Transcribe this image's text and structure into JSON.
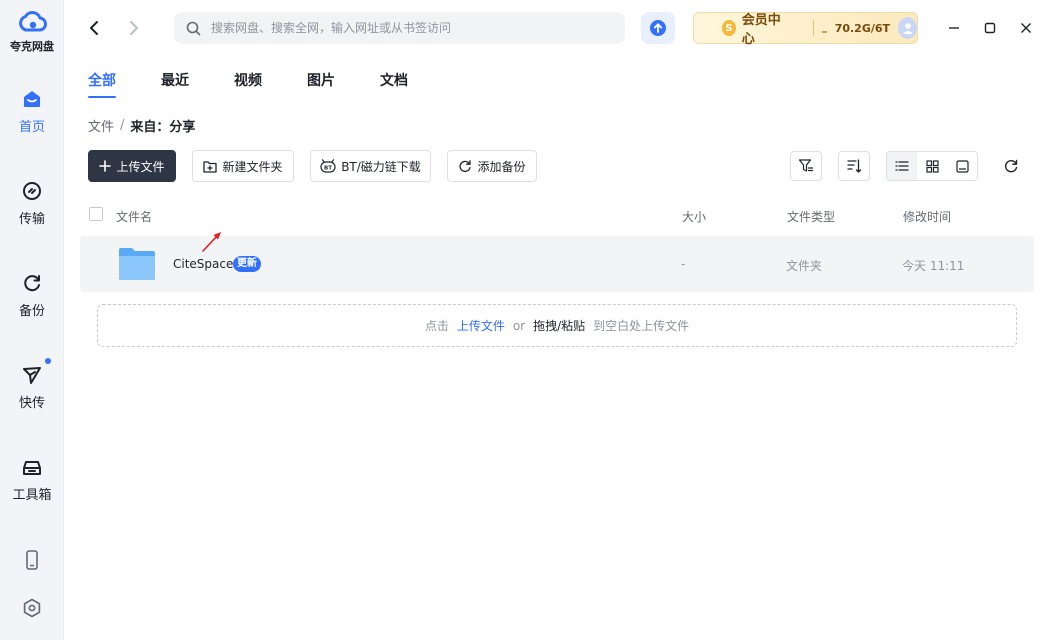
{
  "app": {
    "logo_text": "夸克网盘"
  },
  "sidebar": {
    "items": [
      {
        "label": "首页",
        "icon": "home-icon"
      },
      {
        "label": "传输",
        "icon": "transfer-icon"
      },
      {
        "label": "备份",
        "icon": "backup-icon"
      },
      {
        "label": "快传",
        "icon": "quick-send-icon"
      },
      {
        "label": "工具箱",
        "icon": "toolbox-icon"
      }
    ],
    "bottom_icons": [
      "phone-icon",
      "settings-icon"
    ]
  },
  "topbar": {
    "search_placeholder": "搜索网盘、搜索全网，输入网址或从书签访问",
    "vip": {
      "coin": "S",
      "label": "会员中心",
      "storage": "70.2G/6T"
    }
  },
  "tabs": [
    "全部",
    "最近",
    "视频",
    "图片",
    "文档"
  ],
  "breadcrumb": {
    "root": "文件",
    "separator": "/",
    "current": "来自：分享"
  },
  "toolbar": {
    "upload": "上传文件",
    "new_folder": "新建文件夹",
    "bt_download": "BT/磁力链下载",
    "add_backup": "添加备份",
    "bt_badge": "BT"
  },
  "table": {
    "headers": {
      "name": "文件名",
      "size": "大小",
      "type": "文件类型",
      "modified": "修改时间"
    },
    "rows": [
      {
        "name": "CiteSpace",
        "badge": "更新",
        "size": "-",
        "type": "文件夹",
        "modified": "今天 11:11"
      }
    ]
  },
  "dropzone": {
    "prefix": "点击",
    "link": "上传文件",
    "or": "or",
    "strong": "拖拽/粘贴",
    "suffix": "到空白处上传文件"
  },
  "colors": {
    "accent": "#3370ff",
    "primary_button": "#2e3545",
    "sidebar_bg": "#f2f4f8"
  }
}
